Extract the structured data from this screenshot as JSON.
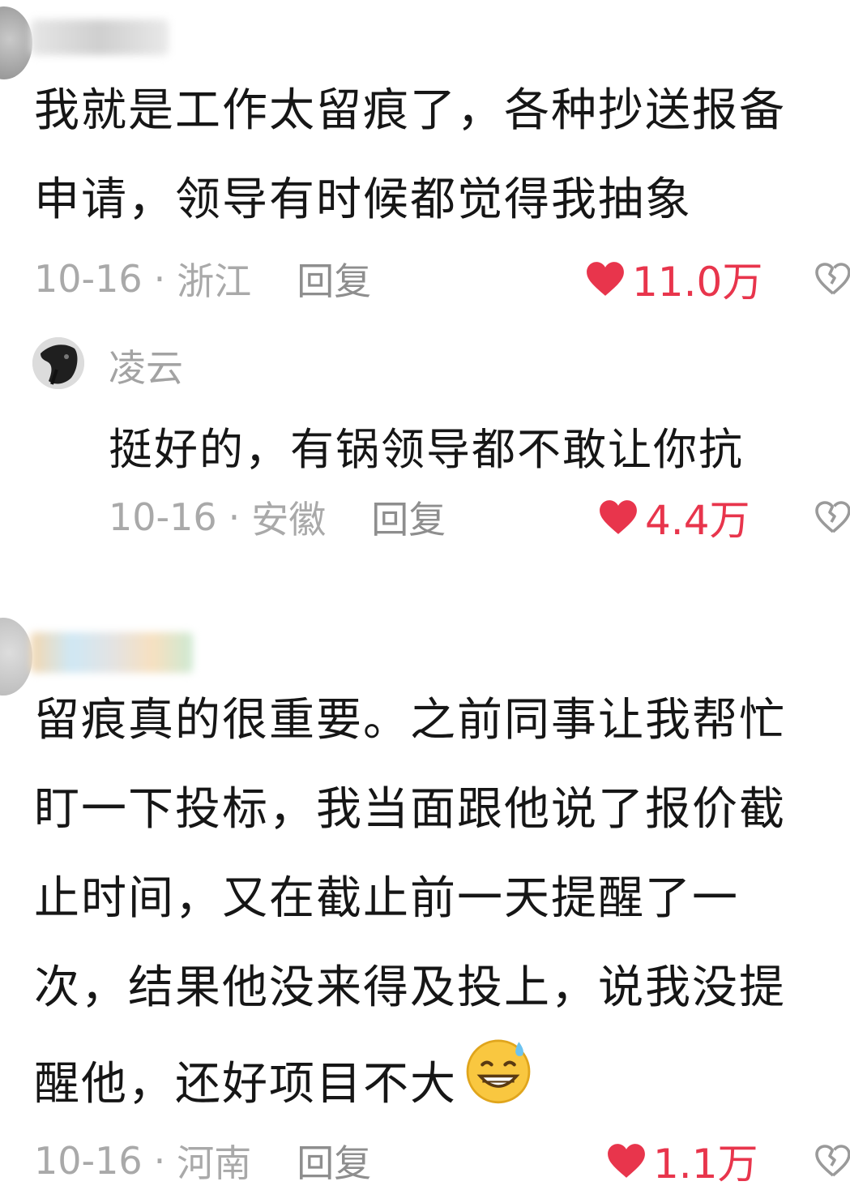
{
  "comments": [
    {
      "text_lines": [
        "我就是工作太留痕了，各种抄送报备",
        "申请，领导有时候都觉得我抽象"
      ],
      "date": "10-16",
      "location": "浙江",
      "reply_label": "回复",
      "likes": "11.0万",
      "replies": [
        {
          "author": "凌云",
          "text": "挺好的，有锅领导都不敢让你抗",
          "date": "10-16",
          "location": "安徽",
          "reply_label": "回复",
          "likes": "4.4万"
        }
      ]
    },
    {
      "text_lines": [
        "留痕真的很重要。之前同事让我帮忙",
        "盯一下投标，我当面跟他说了报价截",
        "止时间，又在截止前一天提醒了一",
        "次，结果他没来得及投上，说我没提",
        "醒他，还好项目不大"
      ],
      "emoji": "😅",
      "date": "10-16",
      "location": "河南",
      "reply_label": "回复",
      "likes": "1.1万"
    }
  ],
  "colors": {
    "like_red": "#e8354c",
    "meta_gray": "#a9a9a9",
    "text": "#161616"
  },
  "icons": {
    "like": "heart-icon",
    "dislike": "broken-heart-icon"
  }
}
